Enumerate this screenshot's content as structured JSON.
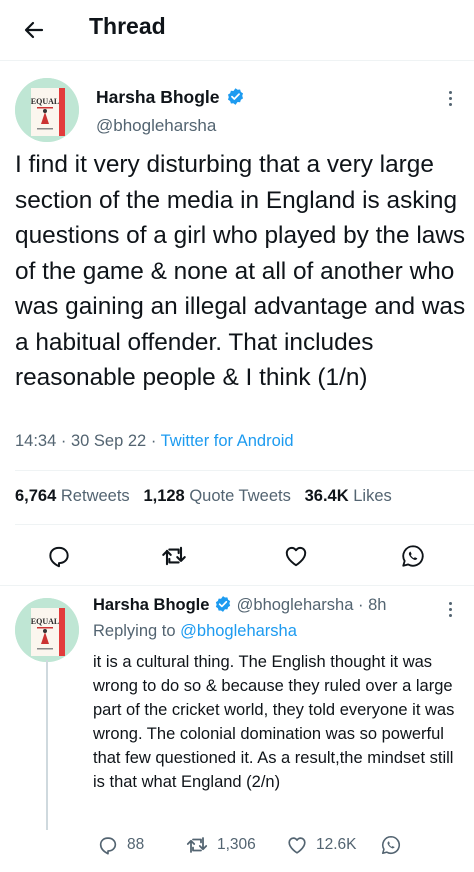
{
  "header": {
    "title": "Thread"
  },
  "tweet": {
    "author_name": "Harsha Bhogle",
    "author_handle": "@bhogleharsha",
    "avatar_book_title": "EQUAL",
    "text": "I find it very disturbing that a very large section of the media in England is asking questions of a girl who played by the laws of the game & none at all of another who was gaining an illegal advantage and was a habitual offender. That includes reasonable people & I think (1/n)",
    "time": "14:34",
    "date": "30 Sep 22",
    "source": "Twitter for Android",
    "sep": "·",
    "retweets": "6,764",
    "retweets_label": "Retweets",
    "quotes": "1,128",
    "quotes_label": "Quote Tweets",
    "likes": "36.4K",
    "likes_label": "Likes"
  },
  "reply": {
    "author_name": "Harsha Bhogle",
    "author_handle": "@bhogleharsha",
    "age": "8h",
    "sep": "·",
    "replying_prefix": "Replying to",
    "replying_handle": "@bhogleharsha",
    "text": "it is a cultural thing. The English thought it was wrong to do so & because they ruled over a large part of the cricket world, they told everyone it was wrong. The colonial domination was so powerful that few questioned it. As a result,the mindset still is that what England (2/n)",
    "replies": "88",
    "retweets": "1,306",
    "likes": "12.6K"
  },
  "colors": {
    "accent": "#1d9bf0",
    "muted": "#536471",
    "text": "#0f1419"
  },
  "icons": [
    "back-arrow-icon",
    "verified-badge-icon",
    "more-icon",
    "reply-icon",
    "retweet-icon",
    "like-icon",
    "whatsapp-icon"
  ]
}
